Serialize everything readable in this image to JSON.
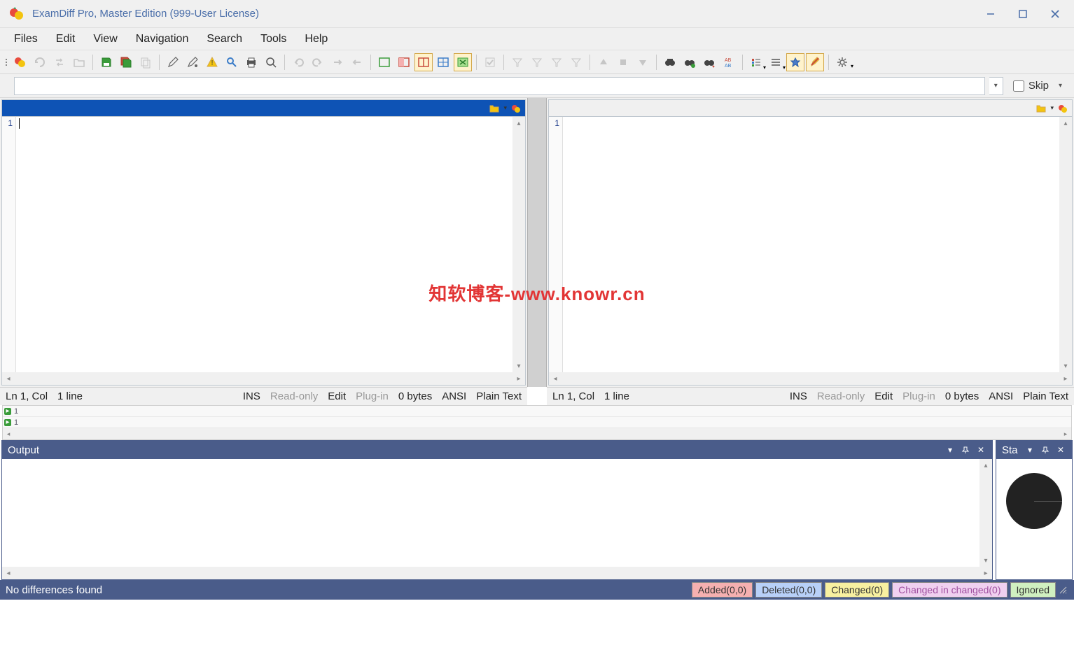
{
  "window": {
    "title": "ExamDiff Pro, Master Edition (999-User License)"
  },
  "menu": {
    "files": "Files",
    "edit": "Edit",
    "view": "View",
    "navigation": "Navigation",
    "search": "Search",
    "tools": "Tools",
    "help": "Help"
  },
  "pathbar": {
    "value": "",
    "skip_label": "Skip"
  },
  "panes": {
    "left": {
      "line_no": "1",
      "status": {
        "pos": "Ln 1, Col",
        "lines": "1 line",
        "ins": "INS",
        "readonly": "Read-only",
        "edit": "Edit",
        "plugin": "Plug-in",
        "bytes": "0 bytes",
        "enc": "ANSI",
        "type": "Plain Text"
      }
    },
    "right": {
      "line_no": "1",
      "status": {
        "pos": "Ln 1, Col",
        "lines": "1 line",
        "ins": "INS",
        "readonly": "Read-only",
        "edit": "Edit",
        "plugin": "Plug-in",
        "bytes": "0 bytes",
        "enc": "ANSI",
        "type": "Plain Text"
      }
    }
  },
  "overview": {
    "row1": "1",
    "row2": "1"
  },
  "panels": {
    "output_title": "Output",
    "stats_title": "Sta"
  },
  "bottom": {
    "message": "No differences found",
    "chips": {
      "added": "Added(0,0)",
      "deleted": "Deleted(0,0)",
      "changed": "Changed(0)",
      "cic": "Changed in changed(0)",
      "ignored": "Ignored"
    }
  },
  "watermark": "知软博客-www.knowr.cn"
}
